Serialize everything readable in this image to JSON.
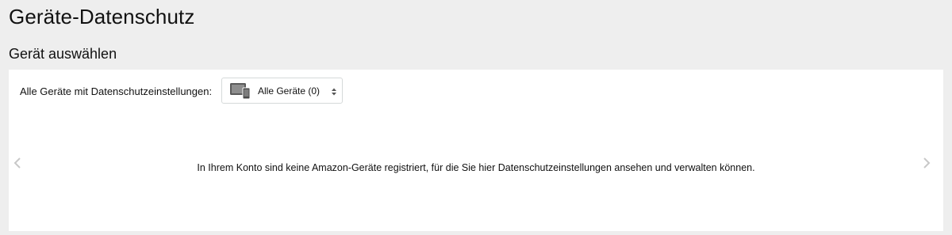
{
  "header": {
    "title": "Geräte-Datenschutz"
  },
  "device_section": {
    "title": "Gerät auswählen",
    "filter_label": "Alle Geräte mit Datenschutzeinstellungen:",
    "select": {
      "icon": "devices-icon",
      "value": "Alle Geräte (0)",
      "indicator": "updown-arrows-icon"
    },
    "empty_message": "In Ihrem Konto sind keine Amazon-Geräte registriert, für die Sie hier Datenschutzeinstellungen ansehen und verwalten können.",
    "navigation": {
      "prev_icon": "chevron-left-icon",
      "next_icon": "chevron-right-icon"
    }
  },
  "colors": {
    "page_background": "#eeeeee",
    "panel_background": "#ffffff",
    "text": "#111111",
    "select_border": "#d5d9d9",
    "arrow": "#c8c8c8"
  }
}
